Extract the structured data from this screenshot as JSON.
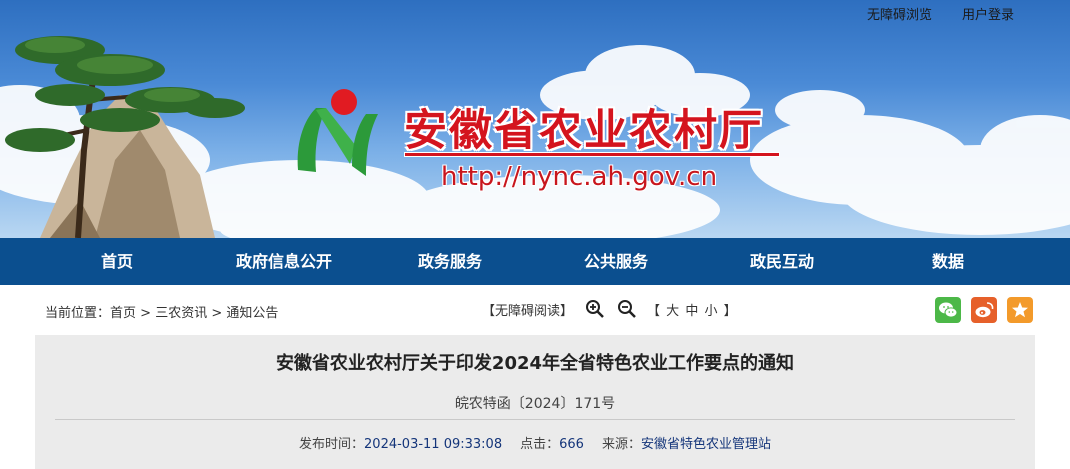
{
  "top_links": {
    "accessible": "无障碍浏览",
    "login": "用户登录"
  },
  "site": {
    "title": "安徽省农业农村厅",
    "url": "http://nync.ah.gov.cn"
  },
  "nav": [
    {
      "label": "首页"
    },
    {
      "label": "政府信息公开"
    },
    {
      "label": "政务服务"
    },
    {
      "label": "公共服务"
    },
    {
      "label": "政民互动"
    },
    {
      "label": "数据"
    }
  ],
  "breadcrumb": {
    "prefix": "当前位置：",
    "items": [
      "首页",
      "三农资讯",
      "通知公告"
    ],
    "separator": " > "
  },
  "tools": {
    "accessible_read": "【无障碍阅读】",
    "size_open": "【",
    "size_large": "大",
    "size_medium": "中",
    "size_small": "小",
    "size_close": "】"
  },
  "share": {
    "wechat_color": "#4cb848",
    "weibo_color": "#e6602a",
    "favorite_color": "#f39a2b"
  },
  "article": {
    "title": "安徽省农业农村厅关于印发2024年全省特色农业工作要点的通知",
    "doc_number": "皖农特函〔2024〕171号",
    "publish_label": "发布时间：",
    "publish_time": "2024-03-11 09:33:08",
    "clicks_label": "点击：",
    "clicks": "666",
    "source_label": "来源：",
    "source": "安徽省特色农业管理站"
  },
  "colors": {
    "nav_bg": "#0b4f8f",
    "title_red": "#d4141e",
    "article_bg": "#ebebeb"
  }
}
